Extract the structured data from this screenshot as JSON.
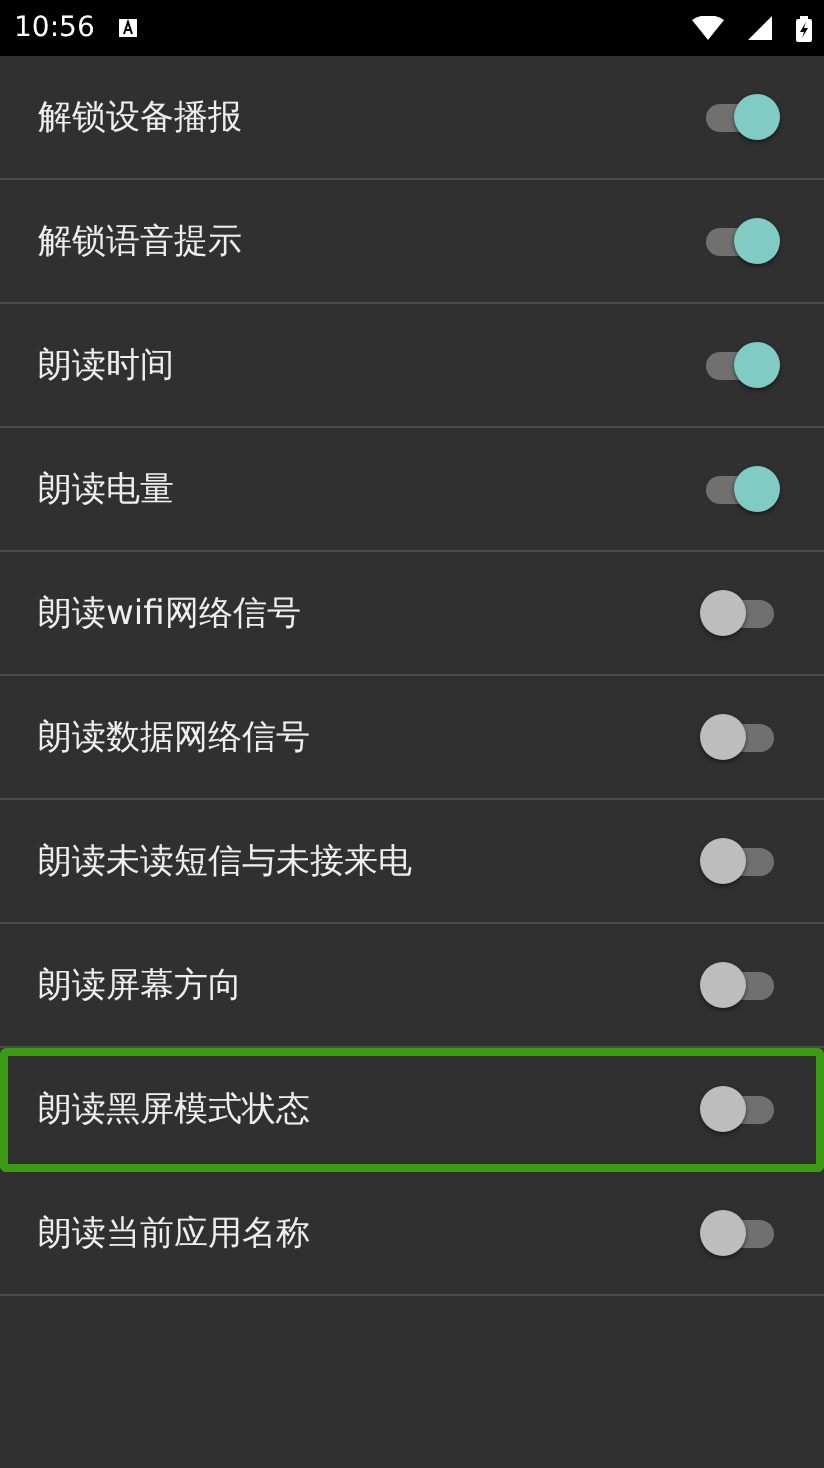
{
  "status_bar": {
    "time": "10:56"
  },
  "settings": [
    {
      "label": "解锁设备播报",
      "on": true,
      "focused": false
    },
    {
      "label": "解锁语音提示",
      "on": true,
      "focused": false
    },
    {
      "label": "朗读时间",
      "on": true,
      "focused": false
    },
    {
      "label": "朗读电量",
      "on": true,
      "focused": false
    },
    {
      "label": "朗读wifi网络信号",
      "on": false,
      "focused": false
    },
    {
      "label": "朗读数据网络信号",
      "on": false,
      "focused": false
    },
    {
      "label": "朗读未读短信与未接来电",
      "on": false,
      "focused": false
    },
    {
      "label": "朗读屏幕方向",
      "on": false,
      "focused": false
    },
    {
      "label": "朗读黑屏模式状态",
      "on": false,
      "focused": true
    },
    {
      "label": "朗读当前应用名称",
      "on": false,
      "focused": false
    }
  ]
}
